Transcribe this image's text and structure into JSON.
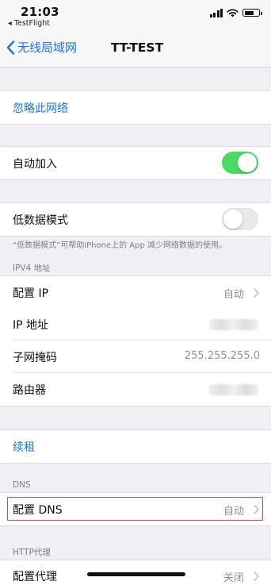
{
  "status_bar": {
    "time": "21:03",
    "back_app": "◂ TestFlight",
    "battery_level": 0.7
  },
  "nav": {
    "back_label": "无线局域网",
    "title": "TT-TEST"
  },
  "forget_network": {
    "label": "忽略此网络"
  },
  "auto_join": {
    "label": "自动加入",
    "on": true
  },
  "low_data_mode": {
    "label": "低数据模式",
    "on": false,
    "footnote": "“低数据模式”可帮助iPhone上的 App 减少网络数据的使用。"
  },
  "ipv4": {
    "header": "IPV4 地址",
    "configure_ip": {
      "label": "配置 IP",
      "value": "自动"
    },
    "ip_address": {
      "label": "IP 地址"
    },
    "subnet_mask": {
      "label": "子网掩码",
      "value": "255.255.255.0"
    },
    "router": {
      "label": "路由器"
    }
  },
  "renew_lease": {
    "label": "续租"
  },
  "dns": {
    "header": "DNS",
    "configure_dns": {
      "label": "配置 DNS",
      "value": "自动"
    }
  },
  "http_proxy": {
    "header": "HTTP代理",
    "configure_proxy": {
      "label": "配置代理",
      "value": "关闭"
    }
  },
  "colors": {
    "accent": "#1a73e8",
    "toggle_on": "#4cd964",
    "highlight": "#e0474c",
    "background": "#efeff4"
  }
}
